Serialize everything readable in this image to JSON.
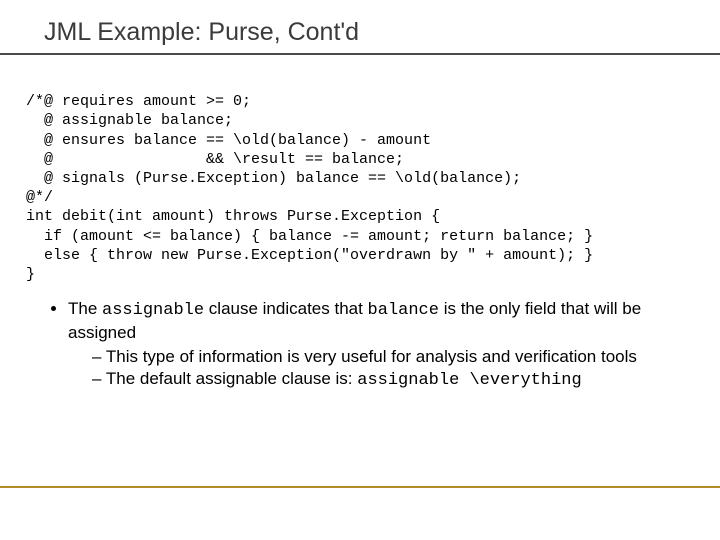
{
  "title": "JML Example: Purse, Cont'd",
  "code": {
    "l1": "/*@ requires amount >= 0;",
    "l2": "  @ assignable balance;",
    "l3": "  @ ensures balance == \\old(balance) - amount",
    "l4": "  @                 && \\result == balance;",
    "l5": "  @ signals (Purse.Exception) balance == \\old(balance);",
    "l6": "@*/",
    "l7": "int debit(int amount) throws Purse.Exception {",
    "l8": "  if (amount <= balance) { balance -= amount; return balance; }",
    "l9": "  else { throw new Purse.Exception(\"overdrawn by \" + amount); }",
    "l10": "}"
  },
  "bullet": {
    "prefix": "The ",
    "kw1": "assignable",
    "mid": " clause indicates that ",
    "kw2": "balance",
    "suffix": " is the only field that will be assigned",
    "sub1": "This type of information is very useful for analysis and verification tools",
    "sub2_prefix": "The default assignable clause is: ",
    "sub2_code": "assignable \\everything"
  }
}
